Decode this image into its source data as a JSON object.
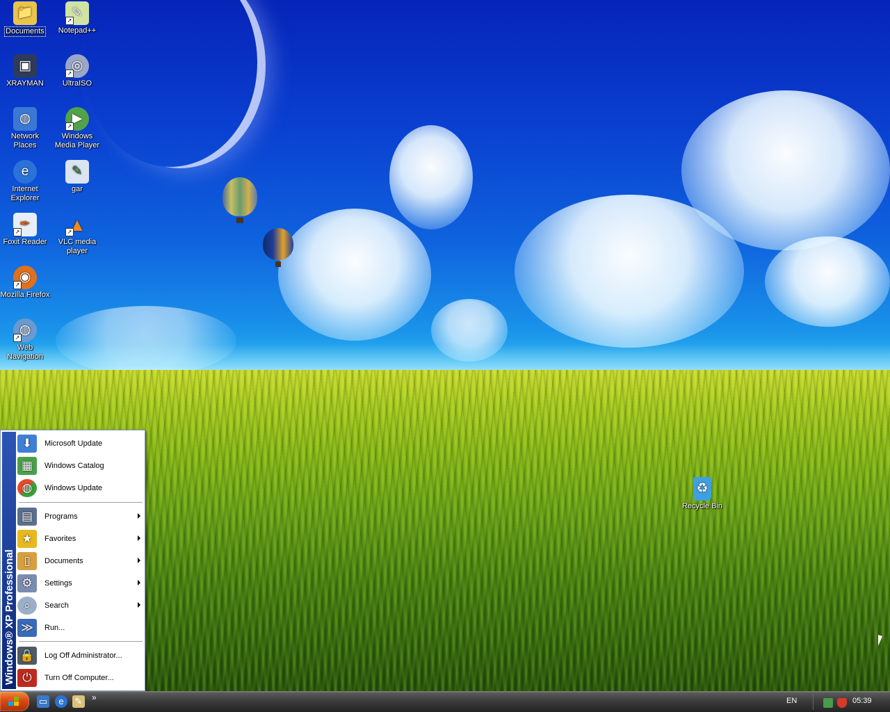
{
  "desktop": {
    "icons": [
      {
        "name": "documents-icon",
        "label": "Documents",
        "color": "#e9c44a",
        "glyph": "📁"
      },
      {
        "name": "notepadpp-icon",
        "label": "Notepad++",
        "color": "#cfe3a4",
        "glyph": "✎"
      },
      {
        "name": "xrayman-icon",
        "label": "XRAYMAN",
        "color": "#2d3a5a",
        "glyph": "▣"
      },
      {
        "name": "ultraiso-icon",
        "label": "UltraISO",
        "color": "#9aa7c8",
        "glyph": "◎"
      },
      {
        "name": "network-places-icon",
        "label": "Network Places",
        "color": "#3a78d6",
        "glyph": "◍"
      },
      {
        "name": "windows-media-player-icon",
        "label": "Windows Media Player",
        "color": "#53a24a",
        "glyph": "▶"
      },
      {
        "name": "internet-explorer-icon",
        "label": "Internet Explorer",
        "color": "#2a72d8",
        "glyph": "e"
      },
      {
        "name": "gar-icon",
        "label": "gar",
        "color": "#dbe4f2",
        "glyph": "✎"
      },
      {
        "name": "foxit-reader-icon",
        "label": "Foxit Reader",
        "color": "#e6eef8",
        "glyph": "✒"
      },
      {
        "name": "vlc-media-player-icon",
        "label": "VLC media player",
        "color": "#f08a1c",
        "glyph": "▲"
      },
      {
        "name": "mozilla-firefox-icon",
        "label": "Mozilla Firefox",
        "color": "#e0701c",
        "glyph": "◉"
      },
      {
        "name": "web-navigation-icon",
        "label": "Web Navigation",
        "color": "#6a9ad0",
        "glyph": "◍"
      },
      {
        "name": "recycle-bin-icon",
        "label": "Recycle Bin",
        "color": "#3fa0e0",
        "glyph": "♻"
      }
    ]
  },
  "start_menu": {
    "band_text": "Windows® XP Professional",
    "top_items": [
      {
        "label": "Microsoft Update",
        "icon": "microsoft-update-icon",
        "color": "#3f7fd6"
      },
      {
        "label": "Windows Catalog",
        "icon": "windows-catalog-icon",
        "color": "#4aa04a"
      },
      {
        "label": "Windows Update",
        "icon": "windows-update-icon",
        "color": "#e24b2a"
      }
    ],
    "main_items": [
      {
        "label": "Programs",
        "icon": "programs-icon",
        "color": "#5a7090",
        "submenu": true
      },
      {
        "label": "Favorites",
        "icon": "favorites-icon",
        "color": "#e8b81e",
        "submenu": true
      },
      {
        "label": "Documents",
        "icon": "documents-menu-icon",
        "color": "#d6a040",
        "submenu": true
      },
      {
        "label": "Settings",
        "icon": "settings-icon",
        "color": "#7a8cb0",
        "submenu": true
      },
      {
        "label": "Search",
        "icon": "search-icon",
        "color": "#9ab0c8",
        "submenu": true
      },
      {
        "label": "Run...",
        "icon": "run-icon",
        "color": "#3a6ab8",
        "submenu": false
      }
    ],
    "bottom_items": [
      {
        "label": "Log Off Administrator...",
        "icon": "log-off-icon",
        "color": "#505a66"
      },
      {
        "label": "Turn Off Computer...",
        "icon": "turn-off-icon",
        "color": "#c02a1e"
      }
    ]
  },
  "taskbar": {
    "quick_launch": [
      {
        "name": "show-desktop-icon",
        "color": "#3a78c8",
        "glyph": "▭"
      },
      {
        "name": "ie-quicklaunch-icon",
        "color": "#2a72d8",
        "glyph": "e"
      },
      {
        "name": "notepad-quicklaunch-icon",
        "color": "#d9c27a",
        "glyph": "✎"
      }
    ],
    "more_glyph": "»",
    "language": "EN",
    "clock": "05:39",
    "tray_icons": [
      {
        "name": "network-tray-icon",
        "color": "#4a9a4a"
      },
      {
        "name": "security-shield-icon",
        "color": "#d83a2a"
      }
    ]
  }
}
